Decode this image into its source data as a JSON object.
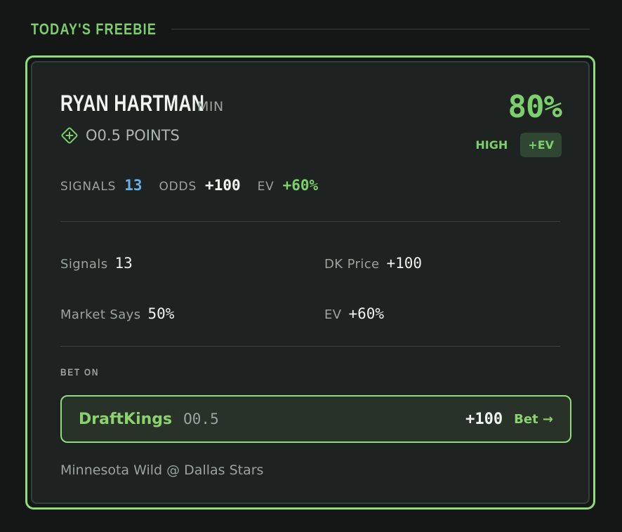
{
  "section": {
    "title": "TODAY'S FREEBIE"
  },
  "pick": {
    "player": "RYAN HARTMAN",
    "team": "MIN",
    "prop": "O0.5 POINTS",
    "prop_icon": "plus-diamond-icon",
    "probability": "80%",
    "confidence": "HIGH",
    "ev_badge": "+EV"
  },
  "strip": {
    "signals_label": "SIGNALS",
    "signals_value": "13",
    "odds_label": "ODDS",
    "odds_value": "+100",
    "ev_label": "EV",
    "ev_value": "+60%"
  },
  "details": {
    "signals_label": "Signals",
    "signals_value": "13",
    "dk_price_label": "DK Price",
    "dk_price_value": "+100",
    "market_label": "Market Says",
    "market_value": "50%",
    "ev_label": "EV",
    "ev_value": "+60%"
  },
  "bet": {
    "heading": "BET ON",
    "book": "DraftKings",
    "line": "O0.5",
    "odds": "+100",
    "button": "Bet →"
  },
  "matchup": "Minnesota Wild @ Dallas Stars",
  "colors": {
    "accent": "#7ccf6c",
    "signals": "#6aaee8",
    "background": "#151716",
    "card": "#1e2321"
  }
}
